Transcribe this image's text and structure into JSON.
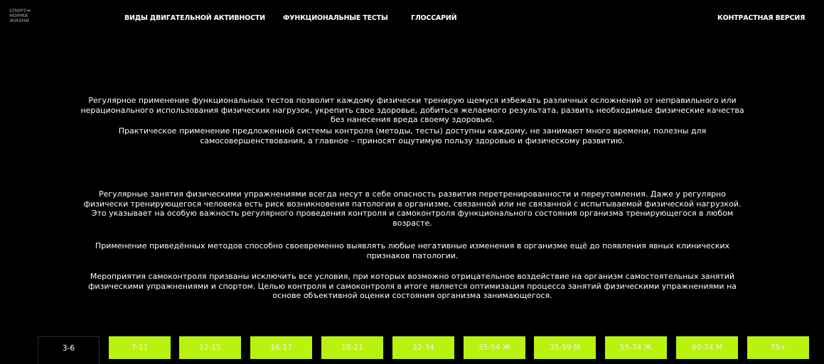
{
  "logo": {
    "lines": [
      "СПОРТ",
      "НОРМА",
      "ЖИЗНИ"
    ],
    "arrow": "→",
    "accent_color": "#c7ff1d"
  },
  "nav": {
    "activity": "ВИДЫ ДВИГАТЕЛЬНОЙ АКТИВНОСТИ",
    "tests": "ФУНКЦИОНАЛЬНЫЕ ТЕСТЫ",
    "glossary": "ГЛОССАРИЙ",
    "contrast": "КОНТРАСТНАЯ ВЕРСИЯ"
  },
  "paragraphs": [
    "Регулярное применение функциональных тестов позволит каждому физически тренирую щемуся избежать различных осложнений от неправильного или нерационального использования физических нагрузок, укрепить свое здоровье, добиться желаемого результата, развить необходимые физические качества без нанесения вреда своему здоровью.",
    "Практическое применение предложенной системы контроля (методы, тесты) доступны каждому, не занимают много времени, полезны для самосовершенствования, а главное – приносят ощутимую пользу здоровью и физическому развитию.",
    "Регулярные занятия физическими упражнениями всегда несут в себе опасность развития перетренированности и переутомления. Даже у регулярно физически тренирующегося человека есть риск возникновения патологии в организме, связанной или не связанной с испытываемой физической нагрузкой. Это указывает на особую важность регулярного проведения контроля и самоконтроля функционального состояния организма тренирующегося в любом возрасте.",
    "Применение приведённых методов способно своевременно выявлять любые негативные изменения в организме ещё до появления явных клинических признаков патологии.",
    "Мероприятия самоконтроля призваны исключить все условия, при которых возможно отрицательное воздействие на организм самостоятельных занятий физическими упражнениями и спортом. Целью контроля и самоконтроля в итоге является оптимизация процесса занятий физическими упражнениями на основе объективной оценки состояния организма занимающегося."
  ],
  "age_tabs": {
    "active": "3-6",
    "items": [
      "3-6",
      "7-11",
      "12-15",
      "16-17",
      "18-21",
      "22-34",
      "35-54 Ж",
      "35-59 М",
      "55-74 Ж",
      "60-74 М",
      "75+"
    ],
    "tab_color": "#b9f20f"
  }
}
